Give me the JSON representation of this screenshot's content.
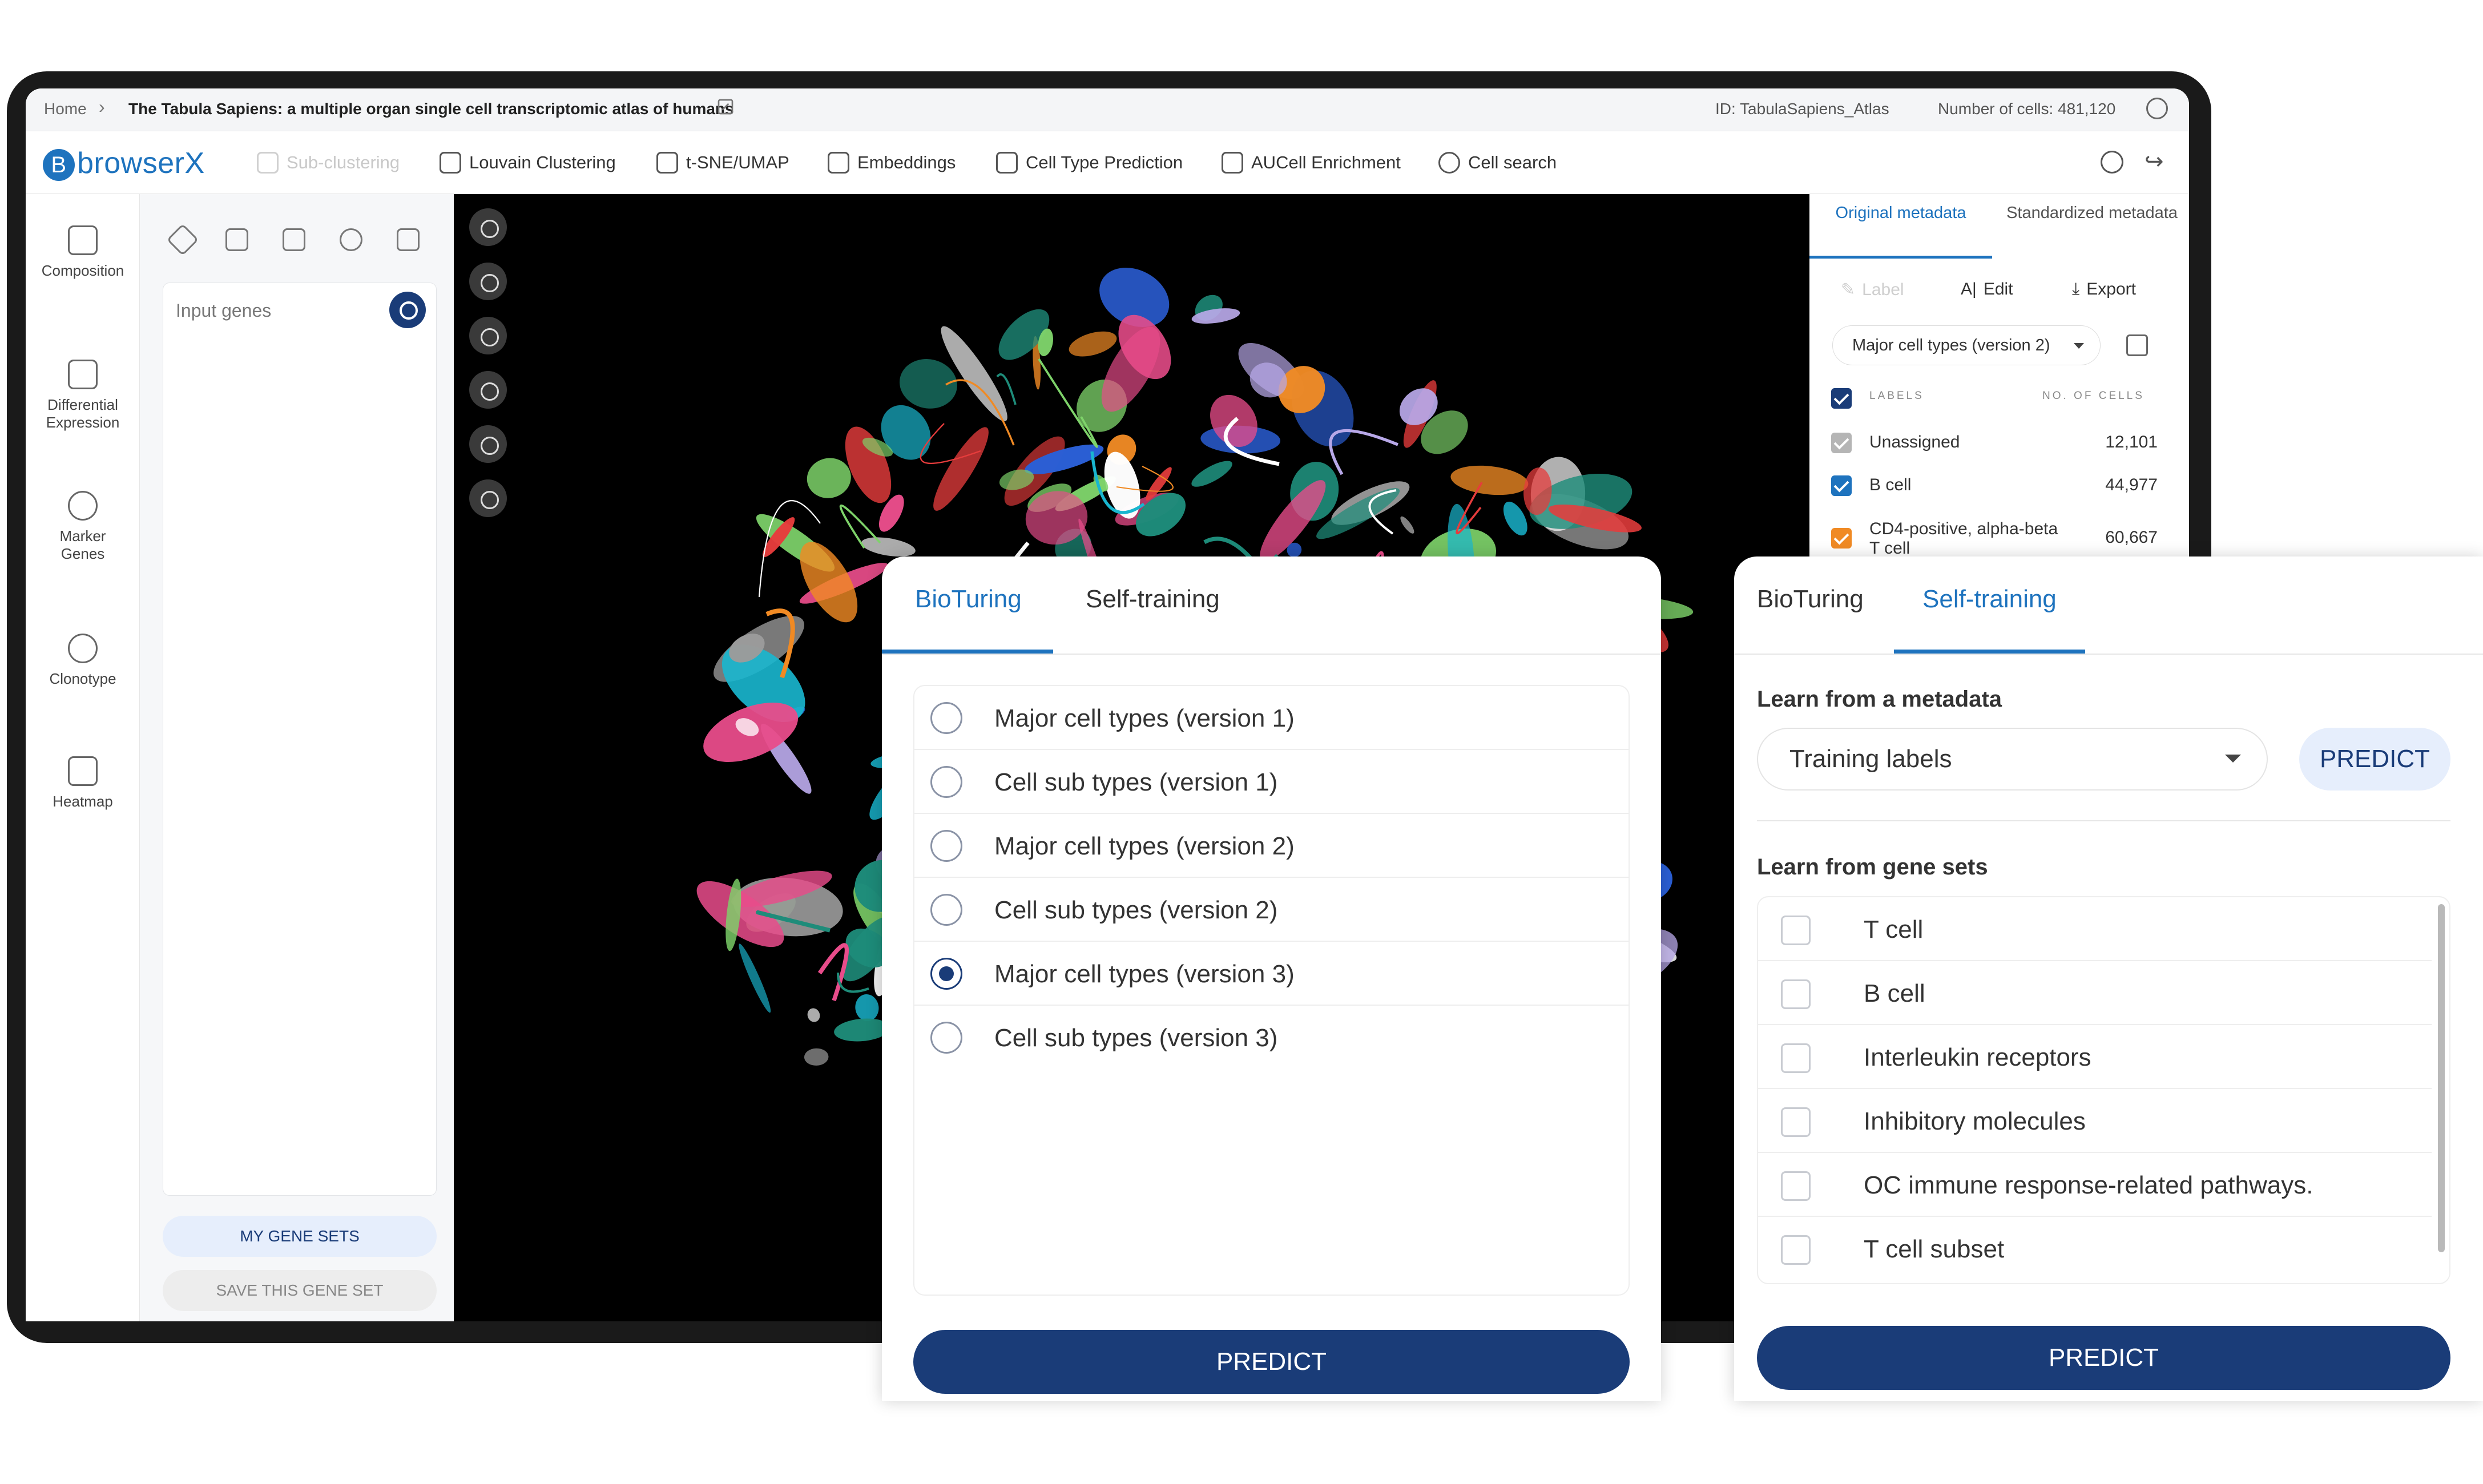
{
  "breadcrumb": {
    "home": "Home",
    "title": "The Tabula Sapiens: a multiple organ single cell transcriptomic atlas of humans",
    "id_text": "ID: TabulaSapiens_Atlas",
    "cells_text": "Number of cells: 481,120"
  },
  "toolbar": {
    "logo": "browserX",
    "items": [
      "Sub-clustering",
      "Louvain Clustering",
      "t-SNE/UMAP",
      "Embeddings",
      "Cell Type Prediction",
      "AUCell Enrichment",
      "Cell search"
    ]
  },
  "leftnav": [
    "Composition",
    "Differential Expression",
    "Marker Genes",
    "Clonotype",
    "Heatmap"
  ],
  "genepanel": {
    "placeholder": "Input genes",
    "my_gene_sets": "MY GENE SETS",
    "save_gene_set": "SAVE THIS GENE SET"
  },
  "metadata": {
    "tabs": [
      "Original metadata",
      "Standardized metadata"
    ],
    "actions": [
      "Label",
      "Edit",
      "Export"
    ],
    "selected": "Major cell types (version 2)",
    "col_labels": "LABELS",
    "col_count": "NO. OF CELLS",
    "rows": [
      {
        "label": "Unassigned",
        "count": "12,101",
        "color": "#b5b5b5"
      },
      {
        "label": "B cell",
        "count": "44,977",
        "color": "#1e73be"
      },
      {
        "label": "CD4-positive, alpha-beta T cell",
        "count": "60,667",
        "color": "#f08a24"
      }
    ]
  },
  "bioturing_card": {
    "tabs": [
      "BioTuring",
      "Self-training"
    ],
    "options": [
      "Major cell types (version 1)",
      "Cell sub types (version 1)",
      "Major cell types (version 2)",
      "Cell sub types (version 2)",
      "Major cell types (version 3)",
      "Cell sub types (version 3)"
    ],
    "selected_index": 4,
    "predict": "PREDICT"
  },
  "selftraining_card": {
    "tabs": [
      "BioTuring",
      "Self-training"
    ],
    "learn_metadata": "Learn from a metadata",
    "training_select": "Training labels",
    "predict_small": "PREDICT",
    "learn_genesets": "Learn from gene sets",
    "genesets": [
      "T cell",
      "B cell",
      "Interleukin receptors",
      "Inhibitory molecules",
      "OC immune response-related pathways.",
      "T cell subset"
    ],
    "predict": "PREDICT"
  },
  "colors": {
    "accent": "#1e73be",
    "primary_button": "#1a3c78",
    "cluster_palette": [
      "#f08a24",
      "#19b6cf",
      "#7ed36a",
      "#e84c8a",
      "#b8a8e8",
      "#2b5fd6",
      "#ffffff",
      "#9b9b9b",
      "#e63c3c",
      "#1e8c7a"
    ]
  }
}
